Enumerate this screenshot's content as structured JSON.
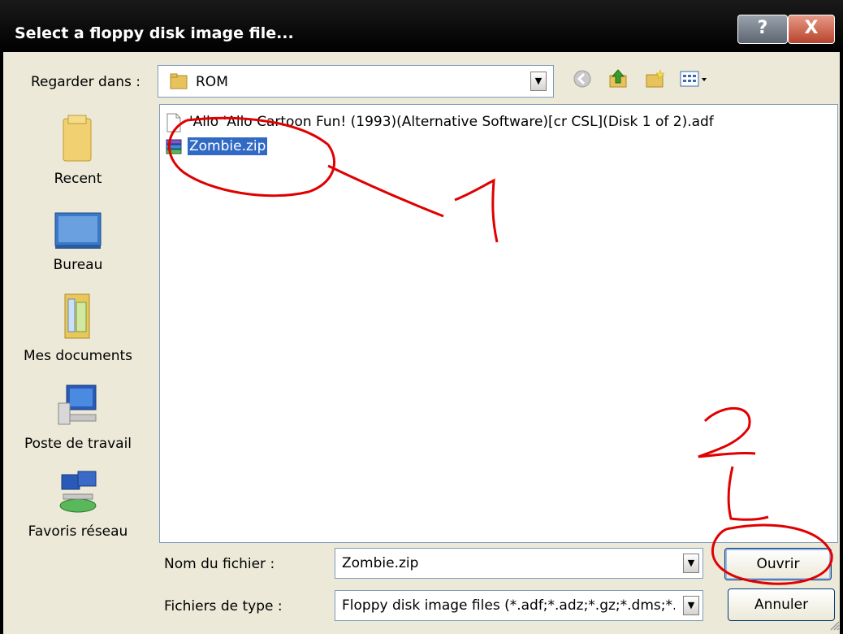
{
  "window": {
    "title": "Select a floppy disk image file...",
    "help_label": "?",
    "close_label": "X"
  },
  "toolbar": {
    "look_in_label": "Regarder dans :",
    "look_in_value": "ROM",
    "icons": [
      "back-arrow-icon",
      "up-folder-icon",
      "new-folder-icon",
      "view-menu-icon"
    ]
  },
  "places": [
    {
      "label": "Recent",
      "icon": "recent-folder-icon"
    },
    {
      "label": "Bureau",
      "icon": "desktop-icon"
    },
    {
      "label": "Mes documents",
      "icon": "my-documents-icon"
    },
    {
      "label": "Poste de travail",
      "icon": "my-computer-icon"
    },
    {
      "label": "Favoris réseau",
      "icon": "network-places-icon"
    }
  ],
  "files": [
    {
      "name": "'Allo 'Allo Cartoon Fun! (1993)(Alternative Software)[cr CSL](Disk 1 of 2).adf",
      "icon": "document-icon",
      "selected": false
    },
    {
      "name": "Zombie.zip",
      "icon": "zip-archive-icon",
      "selected": true
    }
  ],
  "footer": {
    "filename_label": "Nom du fichier :",
    "filename_value": "Zombie.zip",
    "filetype_label": "Fichiers de type :",
    "filetype_value": "Floppy disk image files (*.adf;*.adz;*.gz;*.dms;*.l",
    "open_label": "Ouvrir",
    "cancel_label": "Annuler"
  },
  "annotations": {
    "step1": "1",
    "step2": "2",
    "color": "#e00000"
  }
}
